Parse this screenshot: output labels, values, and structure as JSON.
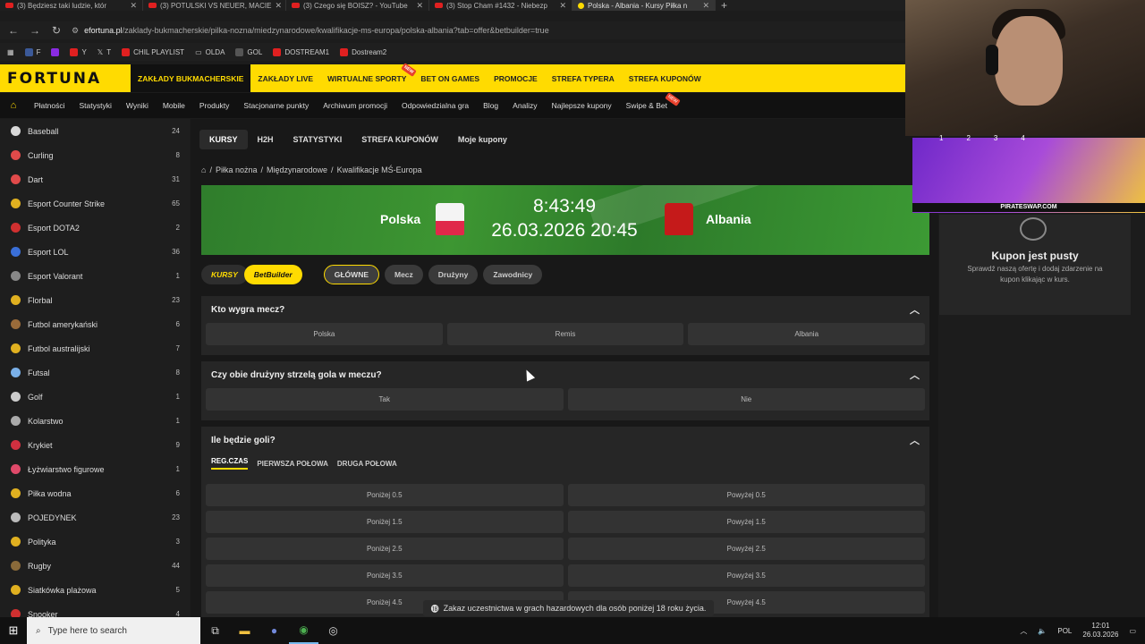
{
  "browser": {
    "tabs": [
      {
        "title": "(3) Będziesz taki ludzie, któr"
      },
      {
        "title": "(3) POTULSKI VS NEUER, MACIE"
      },
      {
        "title": "(3) Czego się BOISZ? - YouTube"
      },
      {
        "title": "(3) Stop Cham #1432 - Niebezp"
      },
      {
        "title": "Polska - Albania - Kursy Piłka n"
      }
    ],
    "url_domain": "efortuna.pl",
    "url_path": "/zaklady-bukmacherskie/pilka-nozna/miedzynarodowe/kwalifikacje-ms-europa/polska-albania?tab=offer&betbuilder=true",
    "bookmarks": [
      "F",
      "Y",
      "T",
      "CHIL PLAYLIST",
      "OLDA",
      "GOL",
      "DOSTREAM1",
      "Dostream2"
    ]
  },
  "header": {
    "logo": "FORTUNA",
    "nav": [
      "ZAKŁADY BUKMACHERSKIE",
      "ZAKŁADY LIVE",
      "WIRTUALNE SPORTY",
      "BET ON GAMES",
      "PROMOCJE",
      "STREFA TYPERA",
      "STREFA KUPONÓW"
    ],
    "new_badge": "NEW",
    "subnav": [
      "Płatności",
      "Statystyki",
      "Wyniki",
      "Mobile",
      "Produkty",
      "Stacjonarne punkty",
      "Archiwum promocji",
      "Odpowiedzialna gra",
      "Blog",
      "Analizy",
      "Najlepsze kupony",
      "Swipe & Bet"
    ]
  },
  "sidebar": {
    "items": [
      {
        "label": "Baseball",
        "count": "24",
        "color": "#d8d8d8"
      },
      {
        "label": "Curling",
        "count": "8",
        "color": "#e04a4a"
      },
      {
        "label": "Dart",
        "count": "31",
        "color": "#e04a4a"
      },
      {
        "label": "Esport Counter Strike",
        "count": "65",
        "color": "#e0b020"
      },
      {
        "label": "Esport DOTA2",
        "count": "2",
        "color": "#d03030"
      },
      {
        "label": "Esport LOL",
        "count": "36",
        "color": "#3a6fd8"
      },
      {
        "label": "Esport Valorant",
        "count": "1",
        "color": "#888888"
      },
      {
        "label": "Florbal",
        "count": "23",
        "color": "#e0b020"
      },
      {
        "label": "Futbol amerykański",
        "count": "6",
        "color": "#9a6b3a"
      },
      {
        "label": "Futbol australijski",
        "count": "7",
        "color": "#e0b020"
      },
      {
        "label": "Futsal",
        "count": "8",
        "color": "#7ab0e8"
      },
      {
        "label": "Golf",
        "count": "1",
        "color": "#cccccc"
      },
      {
        "label": "Kolarstwo",
        "count": "1",
        "color": "#aaaaaa"
      },
      {
        "label": "Krykiet",
        "count": "9",
        "color": "#d03040"
      },
      {
        "label": "Łyżwiarstwo figurowe",
        "count": "1",
        "color": "#e04a6a"
      },
      {
        "label": "Piłka wodna",
        "count": "6",
        "color": "#e0b020"
      },
      {
        "label": "POJEDYNEK",
        "count": "23",
        "color": "#bbbbbb"
      },
      {
        "label": "Polityka",
        "count": "3",
        "color": "#e0b020"
      },
      {
        "label": "Rugby",
        "count": "44",
        "color": "#8a6a3a"
      },
      {
        "label": "Siatkówka plażowa",
        "count": "5",
        "color": "#e0b020"
      },
      {
        "label": "Snooker",
        "count": "4",
        "color": "#d03030"
      }
    ]
  },
  "main": {
    "tabs": [
      "KURSY",
      "H2H",
      "STATYSTYKI",
      "STREFA KUPONÓW",
      "Moje kupony"
    ],
    "breadcrumb": [
      "Piłka nożna",
      "Międzynarodowe",
      "Kwalifikacje MŚ-Europa"
    ],
    "match": {
      "home": "Polska",
      "away": "Albania",
      "clock": "8:43:49",
      "kickoff": "26.03.2026 20:45"
    },
    "pills": [
      "KURSY",
      "BetBuilder",
      "GŁÓWNE",
      "Mecz",
      "Drużyny",
      "Zawodnicy"
    ],
    "markets": {
      "winner": {
        "title": "Kto wygra mecz?",
        "options": [
          "Polska",
          "Remis",
          "Albania"
        ]
      },
      "btts": {
        "title": "Czy obie drużyny strzelą gola w meczu?",
        "options": [
          "Tak",
          "Nie"
        ]
      },
      "goals": {
        "title": "Ile będzie goli?",
        "subtabs": [
          "REG.CZAS",
          "PIERWSZA POŁOWA",
          "DRUGA POŁOWA"
        ],
        "rows": [
          [
            "Poniżej 0.5",
            "Powyżej 0.5"
          ],
          [
            "Poniżej 1.5",
            "Powyżej 1.5"
          ],
          [
            "Poniżej 2.5",
            "Powyżej 2.5"
          ],
          [
            "Poniżej 3.5",
            "Powyżej 3.5"
          ],
          [
            "Poniżej 4.5",
            "Powyżej 4.5"
          ]
        ]
      }
    }
  },
  "kupon": {
    "title": "Kupon jest pusty",
    "subtitle": "Sprawdź naszą ofertę i dodaj zdarzenie na kupon klikając w kurs."
  },
  "overlay": {
    "banner_text": "PIRATESWAP.COM",
    "numbers": [
      "1",
      "2",
      "3",
      "4"
    ]
  },
  "notice": "Zakaz uczestnictwa w grach hazardowych dla osób poniżej 18 roku życia.",
  "taskbar": {
    "search_placeholder": "Type here to search",
    "lang": "POL",
    "time": "12:01",
    "date": "26.03.2026"
  }
}
